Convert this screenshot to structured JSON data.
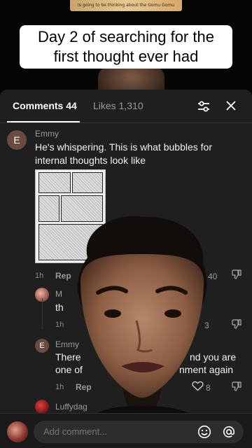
{
  "video": {
    "caption": "Day 2 of searching for the first thought ever had",
    "top_strip_text": "Is going to be thinking about the Gomu Gomu"
  },
  "tabs": {
    "comments_label": "Comments",
    "comments_count": "44",
    "likes_label": "Likes",
    "likes_count": "1,310"
  },
  "comments": [
    {
      "avatar_letter": "E",
      "username": "Emmy",
      "text_line1": "He's whispering. This is what bubbles for",
      "text_line2": "internal thoughts look like",
      "time": "1h",
      "reply_label": "Rep",
      "like_count": "40"
    }
  ],
  "replies": [
    {
      "username": "M",
      "text": "th",
      "time": "1h",
      "like_count": "3"
    },
    {
      "avatar_letter": "E",
      "username": "Emmy",
      "text_line1_left": "There",
      "text_line1_right": "nd you are",
      "text_line2_left": "one of",
      "text_line2_right": "nment again",
      "time": "1h",
      "reply_label": "Rep",
      "like_count": "8"
    },
    {
      "username": "Luffydag"
    }
  ],
  "composer": {
    "placeholder": "Add comment..."
  }
}
